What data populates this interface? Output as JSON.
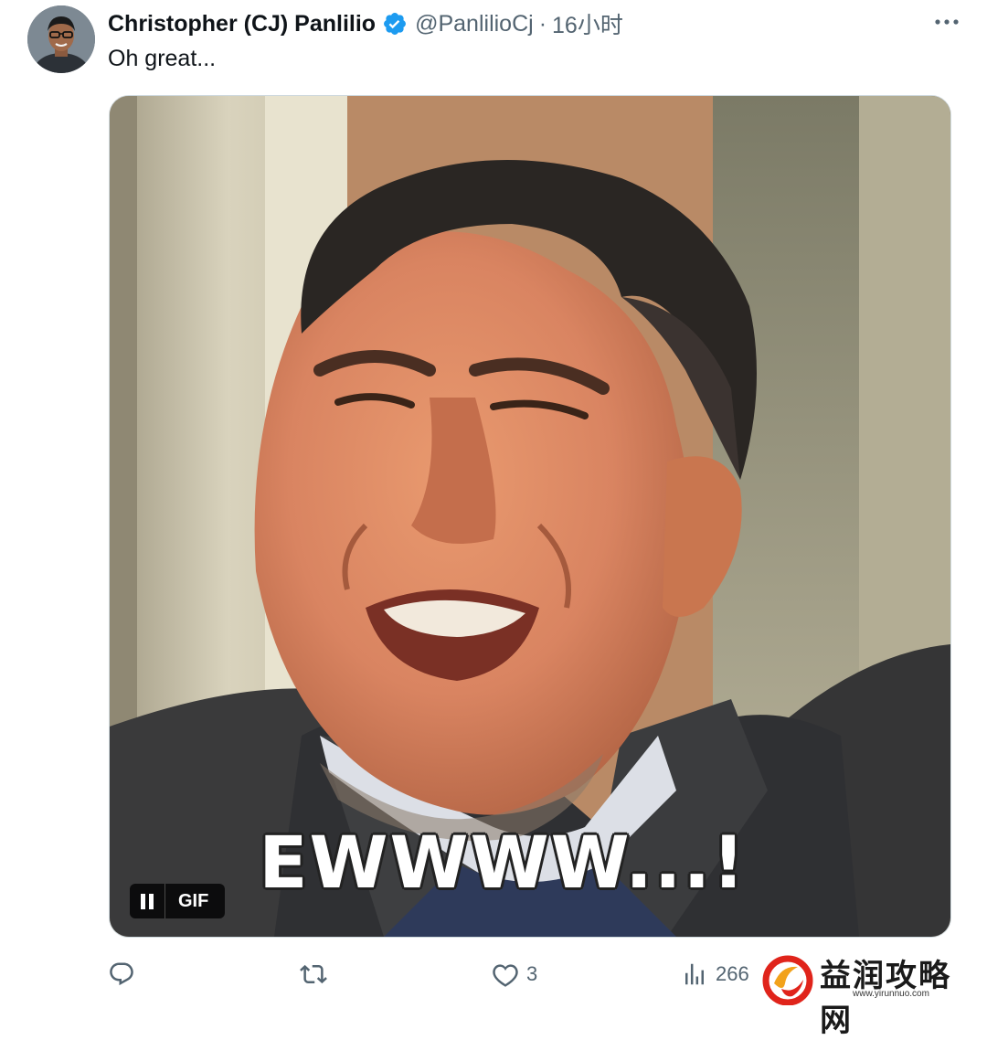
{
  "tweet": {
    "display_name": "Christopher (CJ) Panlilio",
    "handle": "@PanlilioCj",
    "separator": "·",
    "time": "16小时",
    "text": "Oh great...",
    "verified": true
  },
  "media": {
    "type": "GIF",
    "caption": "EWWWW...!",
    "badge_label": "GIF"
  },
  "actions": {
    "reply_count": "",
    "retweet_count": "",
    "like_count": "3",
    "view_count": "266"
  },
  "watermark": {
    "title": "益润攻略网",
    "url": "www.yirunnuo.com"
  },
  "colors": {
    "text_primary": "#0f1419",
    "text_secondary": "#536471",
    "verified_blue": "#1d9bf0",
    "gif_badge_bg": "#000000",
    "watermark_red": "#e0241b"
  },
  "icons": {
    "avatar": "profile-photo",
    "verified": "verified-badge-icon",
    "more": "more-horizontal-icon",
    "reply": "reply-icon",
    "retweet": "retweet-icon",
    "like": "heart-icon",
    "views": "bar-chart-icon",
    "pause": "pause-icon"
  }
}
